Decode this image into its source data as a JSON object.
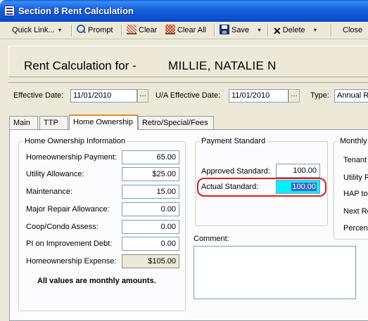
{
  "window": {
    "title": "Section 8 Rent Calculation"
  },
  "toolbar": {
    "quick_link": "Quick Link...",
    "prompt": "Prompt",
    "clear": "Clear",
    "clear_all": "Clear All",
    "save": "Save",
    "delete": "Delete",
    "close": "Close"
  },
  "header": {
    "label": "Rent Calculation for -",
    "name": "MILLIE, NATALIE N"
  },
  "dates": {
    "effective_label": "Effective Date:",
    "effective_value": "11/01/2010",
    "ua_label": "U/A Effective Date:",
    "ua_value": "11/01/2010",
    "type_label": "Type:",
    "type_value": "Annual Re"
  },
  "tabs": [
    {
      "label": "Main"
    },
    {
      "label": "TTP"
    },
    {
      "label": "Home Ownership"
    },
    {
      "label": "Retro/Special/Fees"
    }
  ],
  "home_ownership": {
    "title": "Home Ownership Information",
    "rows": [
      {
        "label": "Homeownership Payment:",
        "value": "65.00"
      },
      {
        "label": "Utility Allowance:",
        "value": "$25.00"
      },
      {
        "label": "Maintenance:",
        "value": "15.00"
      },
      {
        "label": "Major Repair Allowance:",
        "value": "0.00"
      },
      {
        "label": "Coop/Condo Assess:",
        "value": "0.00"
      },
      {
        "label": "PI on Improvement Debt:",
        "value": "0.00"
      },
      {
        "label": "Homeownership Expense:",
        "value": "$105.00"
      }
    ],
    "note": "All values are monthly amounts."
  },
  "payment_standard": {
    "title": "Payment Standard",
    "approved_label": "Approved Standard:",
    "approved_value": "100.00",
    "actual_label": "Actual Standard:",
    "actual_value": "100.00"
  },
  "monthly": {
    "title": "Monthly",
    "rows": [
      {
        "label": "Tenant"
      },
      {
        "label": "Utility R"
      },
      {
        "label": "HAP to"
      },
      {
        "label": "Next Re"
      },
      {
        "label": "Percent"
      }
    ]
  },
  "comment": {
    "label": "Comment:",
    "value": ""
  },
  "colors": {
    "titlebar": "#0a4fd0",
    "active_tab_accent": "#e68b2c",
    "highlight_ring": "#d42020",
    "selection": "#316ac5",
    "actual_standard_bg": "#00f0ff"
  },
  "icons": {
    "app": "app-document-icon",
    "prompt": "magnifier-icon",
    "clear": "clear-icon",
    "clear_all": "clear-all-icon",
    "save": "floppy-disk-icon",
    "delete": "delete-x-icon"
  }
}
